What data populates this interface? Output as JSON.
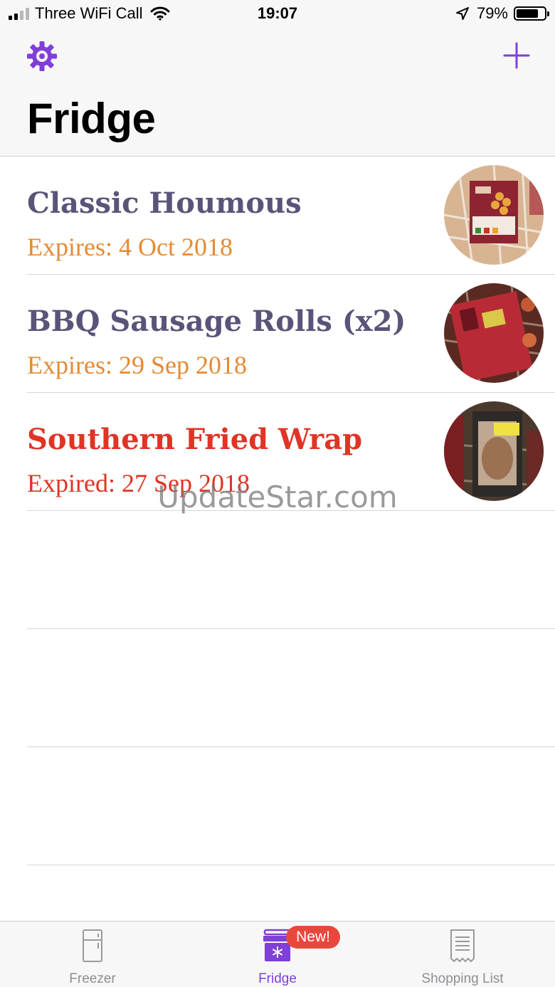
{
  "status_bar": {
    "carrier": "Three WiFi Call",
    "time": "19:07",
    "battery_percent": "79%",
    "battery_level": 0.79
  },
  "nav": {
    "title": "Fridge",
    "settings_icon": "gear-icon",
    "add_icon": "plus-icon",
    "accent_color": "#7f3fd8"
  },
  "items": [
    {
      "name": "Classic Houmous",
      "expiry": "Expires: 4 Oct 2018",
      "status": "ok",
      "name_color": "#5a5479",
      "expiry_color": "#e58a33"
    },
    {
      "name": "BBQ Sausage Rolls (x2)",
      "expiry": "Expires: 29 Sep 2018",
      "status": "ok",
      "name_color": "#5a5479",
      "expiry_color": "#e58a33"
    },
    {
      "name": "Southern Fried Wrap",
      "expiry": "Expired: 27 Sep 2018",
      "status": "expired",
      "name_color": "#e03424",
      "expiry_color": "#e03424"
    }
  ],
  "watermark": "UpdateStar.com",
  "tabs": [
    {
      "label": "Freezer",
      "icon": "freezer-icon",
      "active": false
    },
    {
      "label": "Fridge",
      "icon": "fridge-icon",
      "active": true
    },
    {
      "label": "Shopping List",
      "icon": "receipt-icon",
      "active": false,
      "badge": "New!"
    }
  ]
}
